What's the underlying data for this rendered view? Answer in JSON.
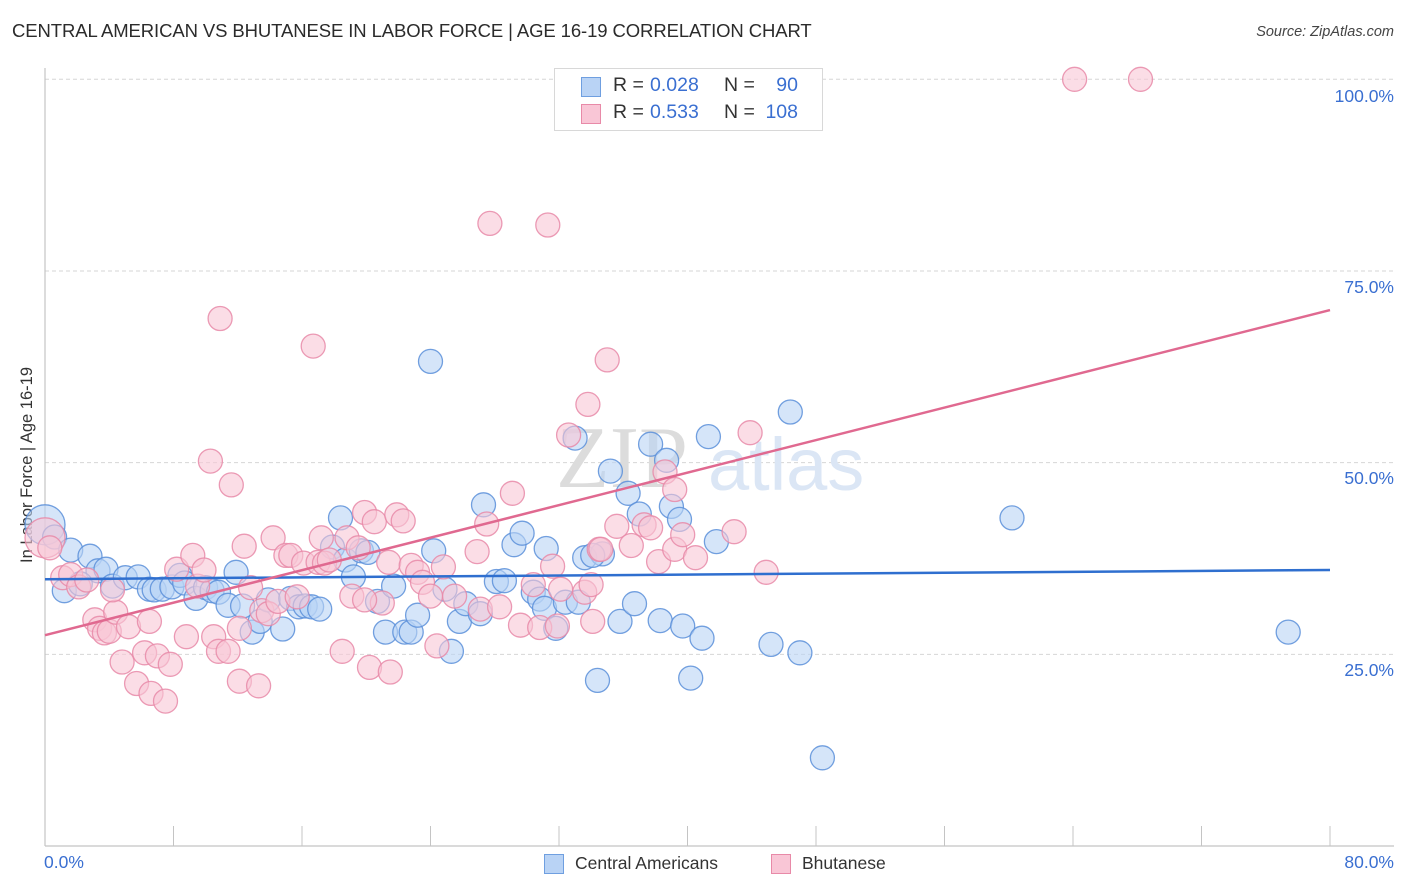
{
  "header": {
    "title": "CENTRAL AMERICAN VS BHUTANESE IN LABOR FORCE | AGE 16-19 CORRELATION CHART",
    "source": "Source: ZipAtlas.com"
  },
  "watermark": {
    "zip": "ZIP",
    "atlas": "atlas"
  },
  "legend_top": {
    "rows": [
      {
        "r_label": "R =",
        "r_value": "0.028",
        "n_label": "N =",
        "n_value": "90",
        "color_fill": "#b9d3f5",
        "color_border": "#6f9fe0"
      },
      {
        "r_label": "R =",
        "r_value": "0.533",
        "n_label": "N =",
        "n_value": "108",
        "color_fill": "#f9c6d6",
        "color_border": "#e88aa8"
      }
    ]
  },
  "legend_bottom": {
    "items": [
      {
        "label": "Central Americans",
        "color_fill": "#b9d3f5",
        "color_border": "#6f9fe0"
      },
      {
        "label": "Bhutanese",
        "color_fill": "#f9c6d6",
        "color_border": "#e88aa8"
      }
    ]
  },
  "chart_data": {
    "type": "scatter",
    "title": "CENTRAL AMERICAN VS BHUTANESE IN LABOR FORCE | AGE 16-19 CORRELATION CHART",
    "xlabel": "",
    "ylabel": "In Labor Force | Age 16-19",
    "xlim": [
      0,
      80
    ],
    "ylim": [
      0,
      105
    ],
    "x_tick_labels": [
      "0.0%",
      "80.0%"
    ],
    "x_minor_ticks": [
      0,
      8,
      16,
      24,
      32,
      40,
      48,
      56,
      64,
      72,
      80
    ],
    "y_ticks": [
      25,
      50,
      75,
      100
    ],
    "y_tick_labels": [
      "25.0%",
      "50.0%",
      "75.0%",
      "100.0%"
    ],
    "grid": "horizontal dashed",
    "legend_placement": "top-center and bottom",
    "series": [
      {
        "name": "Central Americans",
        "color": "#5b8fd9",
        "fill": "#b9d3f5",
        "r": 0.028,
        "n": 90,
        "trend": {
          "x": [
            0,
            80
          ],
          "y": [
            34.8,
            36.0
          ],
          "color": "#2f6fcf"
        },
        "points": [
          [
            0.0,
            41.9,
            "l"
          ],
          [
            0.6,
            40.3
          ],
          [
            1.6,
            38.6
          ],
          [
            2.8,
            37.8
          ],
          [
            3.3,
            35.9
          ],
          [
            3.8,
            36.1
          ],
          [
            4.2,
            33.9
          ],
          [
            5.0,
            35.0
          ],
          [
            5.8,
            35.1
          ],
          [
            6.5,
            33.5
          ],
          [
            6.8,
            33.4
          ],
          [
            7.3,
            33.5
          ],
          [
            7.9,
            33.8
          ],
          [
            8.4,
            35.3
          ],
          [
            8.7,
            34.3
          ],
          [
            9.4,
            32.3
          ],
          [
            10.0,
            33.7
          ],
          [
            10.4,
            33.3
          ],
          [
            10.8,
            33.1
          ],
          [
            11.4,
            31.4
          ],
          [
            11.9,
            35.7
          ],
          [
            12.3,
            31.3
          ],
          [
            12.9,
            27.9
          ],
          [
            13.4,
            29.3
          ],
          [
            13.9,
            32.1
          ],
          [
            14.8,
            28.3
          ],
          [
            15.3,
            32.3
          ],
          [
            15.8,
            31.2
          ],
          [
            16.2,
            31.3
          ],
          [
            16.6,
            31.2
          ],
          [
            17.1,
            30.9
          ],
          [
            17.9,
            39.0
          ],
          [
            18.4,
            42.8
          ],
          [
            18.7,
            37.3
          ],
          [
            19.2,
            35.1
          ],
          [
            19.7,
            38.5
          ],
          [
            20.1,
            38.3
          ],
          [
            20.7,
            31.9
          ],
          [
            21.2,
            27.9
          ],
          [
            21.7,
            33.9
          ],
          [
            22.4,
            27.9
          ],
          [
            22.8,
            27.9
          ],
          [
            23.2,
            30.1
          ],
          [
            24.2,
            38.5
          ],
          [
            24.9,
            33.5
          ],
          [
            25.3,
            25.4
          ],
          [
            25.8,
            29.3
          ],
          [
            26.2,
            31.6
          ],
          [
            27.1,
            30.3
          ],
          [
            27.3,
            44.5
          ],
          [
            28.1,
            34.5
          ],
          [
            28.6,
            34.6
          ],
          [
            29.2,
            39.3
          ],
          [
            29.7,
            40.8
          ],
          [
            30.4,
            33.1
          ],
          [
            30.8,
            32.2
          ],
          [
            31.1,
            31.0
          ],
          [
            31.8,
            28.4
          ],
          [
            32.4,
            31.8
          ],
          [
            33.0,
            53.2
          ],
          [
            33.2,
            31.8
          ],
          [
            33.6,
            37.6
          ],
          [
            34.4,
            21.6
          ],
          [
            34.7,
            38.1
          ],
          [
            35.2,
            48.9
          ],
          [
            35.8,
            29.3
          ],
          [
            36.3,
            46.0
          ],
          [
            36.7,
            31.6
          ],
          [
            37.0,
            43.3
          ],
          [
            37.7,
            52.4
          ],
          [
            38.3,
            29.4
          ],
          [
            38.7,
            50.3
          ],
          [
            39.0,
            44.3
          ],
          [
            39.5,
            42.6
          ],
          [
            39.7,
            28.7
          ],
          [
            40.2,
            21.9
          ],
          [
            40.9,
            27.1
          ],
          [
            41.3,
            53.4
          ],
          [
            41.8,
            39.7
          ],
          [
            45.2,
            26.3
          ],
          [
            46.4,
            56.6
          ],
          [
            47.0,
            25.2
          ],
          [
            48.4,
            11.5
          ],
          [
            60.2,
            42.8
          ],
          [
            77.4,
            27.9
          ],
          [
            24.0,
            63.2
          ],
          [
            31.2,
            38.8
          ],
          [
            34.1,
            37.9
          ],
          [
            1.2,
            33.3
          ],
          [
            2.2,
            34.2
          ]
        ]
      },
      {
        "name": "Bhutanese",
        "color": "#e88aa8",
        "fill": "#f9c6d6",
        "r": 0.533,
        "n": 108,
        "trend": {
          "x": [
            0,
            80
          ],
          "y": [
            27.5,
            69.9
          ],
          "color": "#e06990"
        },
        "points": [
          [
            0.0,
            40.2,
            "l"
          ],
          [
            0.3,
            38.9
          ],
          [
            1.1,
            35.0
          ],
          [
            1.6,
            35.4
          ],
          [
            2.1,
            33.8
          ],
          [
            2.6,
            34.7
          ],
          [
            3.1,
            29.5
          ],
          [
            3.4,
            28.4
          ],
          [
            3.7,
            27.8
          ],
          [
            4.0,
            28.0
          ],
          [
            4.4,
            30.5
          ],
          [
            4.8,
            24.0
          ],
          [
            5.2,
            28.6
          ],
          [
            5.7,
            21.2
          ],
          [
            6.2,
            25.2
          ],
          [
            6.6,
            19.9
          ],
          [
            7.0,
            24.8
          ],
          [
            7.5,
            18.9
          ],
          [
            7.8,
            23.7
          ],
          [
            8.2,
            36.1
          ],
          [
            8.8,
            27.3
          ],
          [
            9.2,
            37.9
          ],
          [
            9.5,
            33.9
          ],
          [
            9.9,
            36.0
          ],
          [
            10.3,
            50.2
          ],
          [
            10.5,
            27.3
          ],
          [
            10.8,
            25.4
          ],
          [
            10.9,
            68.8
          ],
          [
            11.4,
            25.4
          ],
          [
            11.6,
            47.1
          ],
          [
            12.1,
            21.5
          ],
          [
            12.4,
            39.1
          ],
          [
            12.8,
            33.7
          ],
          [
            13.3,
            20.9
          ],
          [
            13.5,
            30.7
          ],
          [
            13.9,
            30.3
          ],
          [
            14.2,
            40.2
          ],
          [
            14.5,
            31.9
          ],
          [
            15.0,
            37.9
          ],
          [
            15.3,
            37.9
          ],
          [
            15.7,
            32.5
          ],
          [
            16.1,
            36.9
          ],
          [
            16.7,
            65.2
          ],
          [
            17.0,
            37.0
          ],
          [
            17.2,
            40.2
          ],
          [
            17.4,
            36.9
          ],
          [
            17.7,
            37.3
          ],
          [
            18.5,
            25.4
          ],
          [
            18.8,
            40.2
          ],
          [
            19.1,
            32.6
          ],
          [
            19.5,
            38.9
          ],
          [
            19.9,
            43.5
          ],
          [
            20.2,
            23.3
          ],
          [
            20.5,
            42.3
          ],
          [
            21.0,
            31.7
          ],
          [
            21.4,
            37.0
          ],
          [
            21.5,
            22.7
          ],
          [
            21.9,
            43.2
          ],
          [
            22.3,
            42.4
          ],
          [
            22.8,
            36.6
          ],
          [
            23.2,
            35.7
          ],
          [
            23.5,
            34.4
          ],
          [
            24.0,
            32.6
          ],
          [
            24.4,
            26.1
          ],
          [
            24.8,
            36.4
          ],
          [
            25.5,
            32.6
          ],
          [
            26.9,
            38.4
          ],
          [
            27.1,
            30.9
          ],
          [
            27.5,
            42.0
          ],
          [
            27.7,
            81.2
          ],
          [
            28.3,
            31.2
          ],
          [
            29.1,
            46.0
          ],
          [
            29.6,
            28.8
          ],
          [
            30.4,
            34.1
          ],
          [
            30.8,
            28.5
          ],
          [
            31.3,
            81.0
          ],
          [
            31.6,
            36.5
          ],
          [
            31.9,
            28.7
          ],
          [
            32.1,
            33.5
          ],
          [
            32.6,
            53.6
          ],
          [
            33.6,
            33.1
          ],
          [
            33.8,
            57.6
          ],
          [
            34.0,
            34.1
          ],
          [
            34.5,
            38.7
          ],
          [
            34.6,
            38.7
          ],
          [
            35.0,
            63.4
          ],
          [
            35.6,
            41.7
          ],
          [
            36.5,
            39.2
          ],
          [
            37.3,
            41.9
          ],
          [
            37.7,
            41.5
          ],
          [
            38.2,
            37.1
          ],
          [
            38.6,
            48.8
          ],
          [
            39.2,
            46.5
          ],
          [
            39.2,
            38.7
          ],
          [
            39.7,
            40.6
          ],
          [
            40.5,
            37.6
          ],
          [
            42.9,
            41.0
          ],
          [
            43.9,
            53.9
          ],
          [
            44.9,
            35.7
          ],
          [
            64.1,
            100.0
          ],
          [
            68.2,
            100.0
          ],
          [
            34.1,
            29.3
          ],
          [
            4.2,
            33.4
          ],
          [
            6.5,
            29.3
          ],
          [
            19.9,
            32.1
          ],
          [
            12.1,
            28.4
          ]
        ]
      }
    ]
  }
}
